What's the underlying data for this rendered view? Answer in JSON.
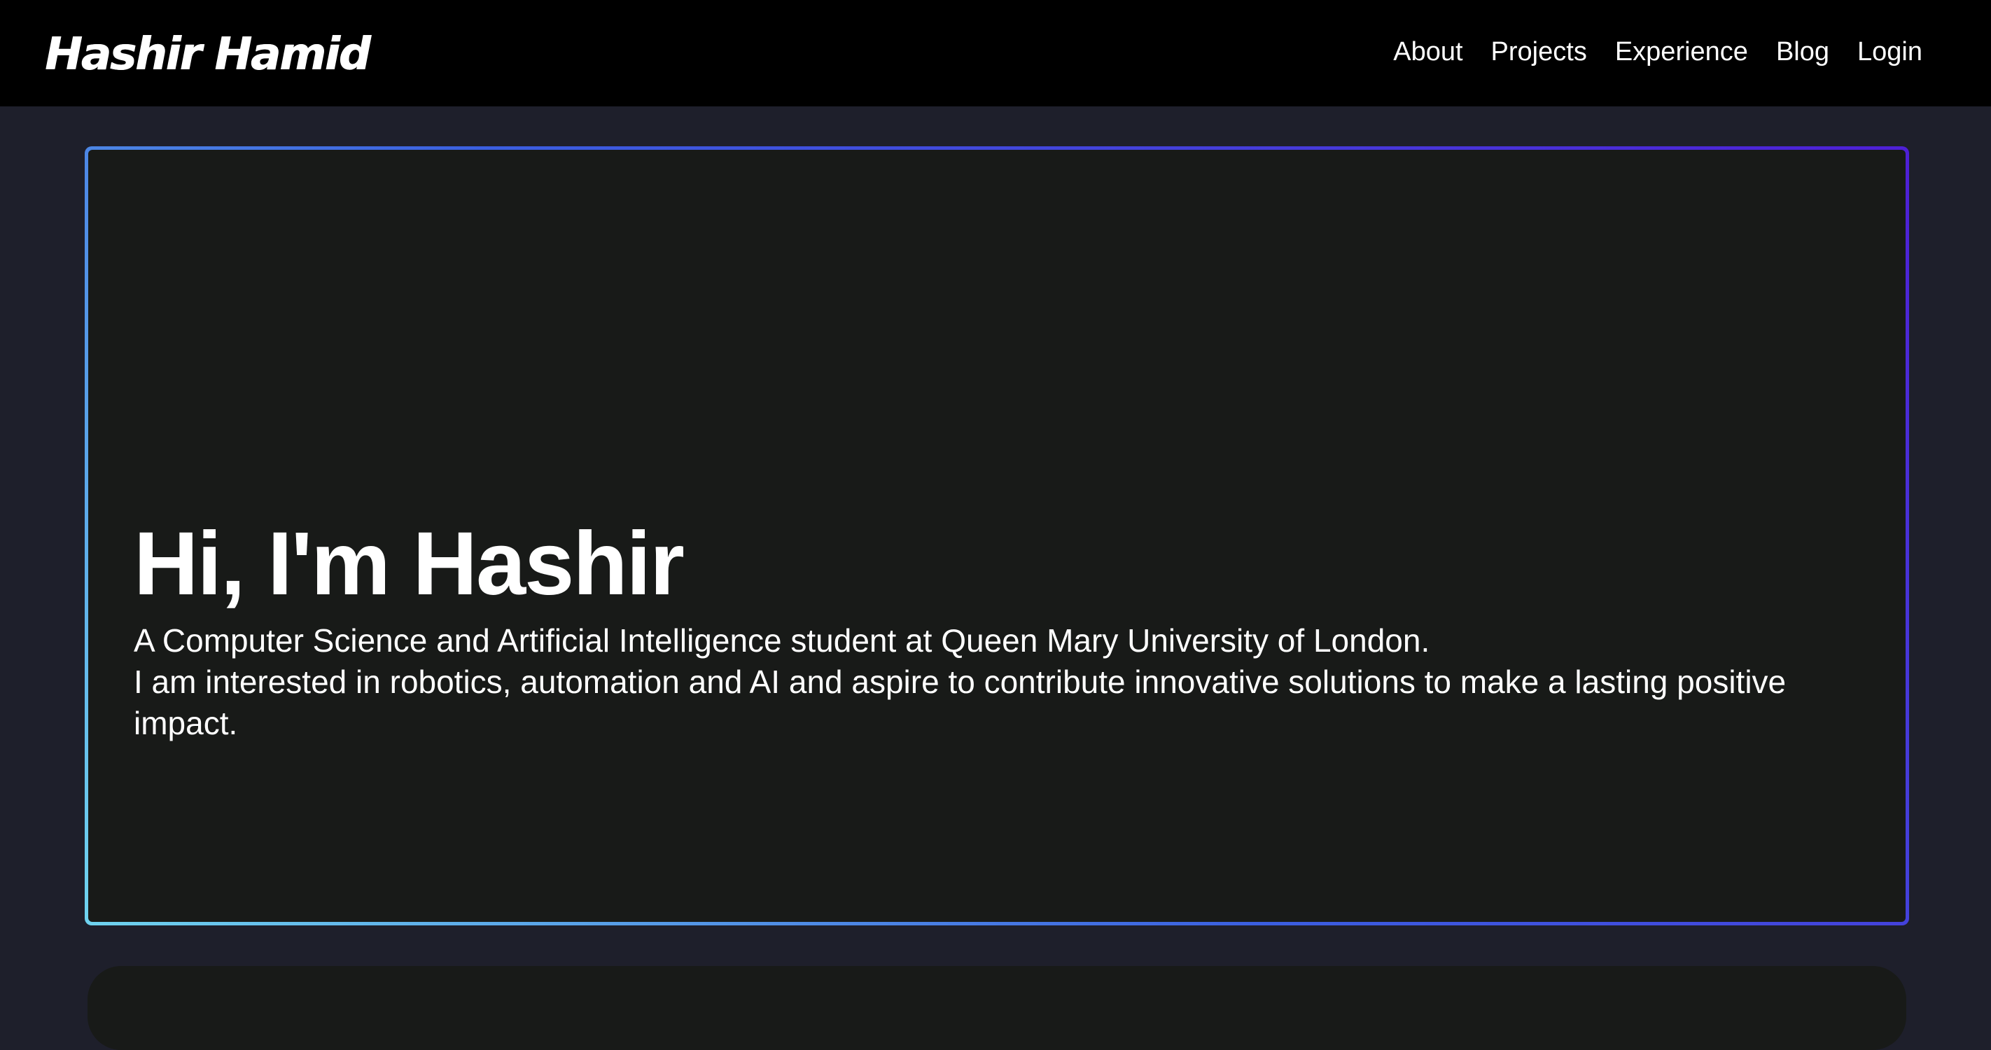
{
  "header": {
    "logo": "Hashir Hamid",
    "nav": [
      {
        "label": "About"
      },
      {
        "label": "Projects"
      },
      {
        "label": "Experience"
      },
      {
        "label": "Blog"
      },
      {
        "label": "Login"
      }
    ]
  },
  "hero": {
    "title": "Hi, I'm Hashir",
    "line1": "A Computer Science and Artificial Intelligence student at Queen Mary University of London.",
    "line2": "I am interested in robotics, automation and AI and aspire to contribute innovative solutions to make a lasting positive impact."
  },
  "colors": {
    "nav_bg": "#000000",
    "page_bg": "#1e1f2b",
    "card_bg": "#181a18",
    "gradient_start": "#6fd3ef",
    "gradient_mid": "#3b5fe0",
    "gradient_end": "#4e1fd6"
  }
}
